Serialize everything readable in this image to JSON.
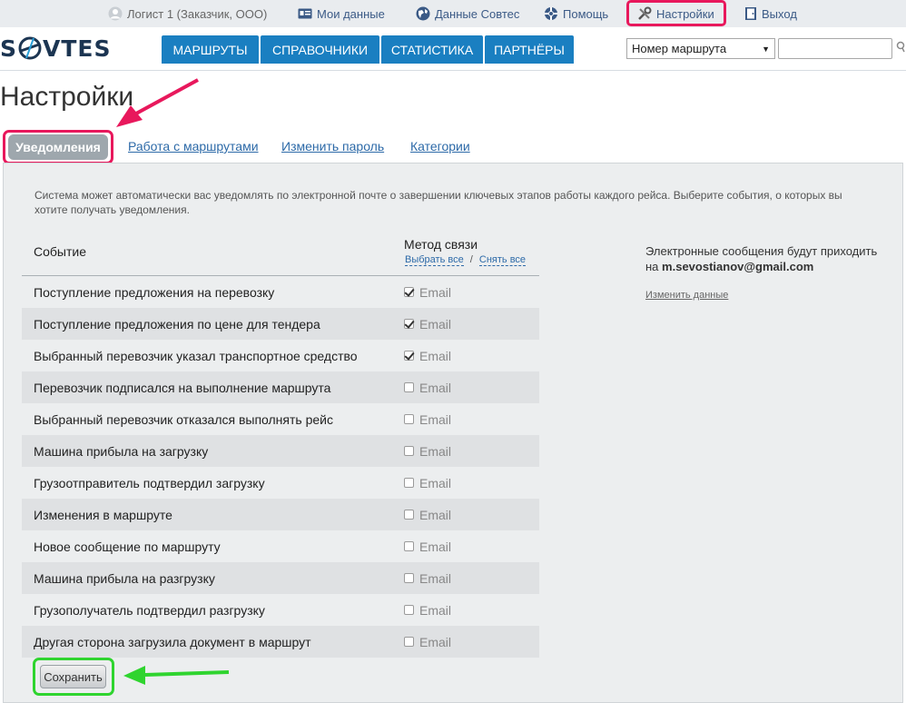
{
  "topbar": {
    "user": "Логист 1 (Заказчик, ООО)",
    "my_data": "Мои данные",
    "sovtes_data": "Данные Совтес",
    "help": "Помощь",
    "settings": "Настройки",
    "logout": "Выход"
  },
  "logo": {
    "text": "SOVTES",
    "left": "S",
    "right": "VTES"
  },
  "mainnav": [
    "МАРШРУТЫ",
    "СПРАВОЧНИКИ",
    "СТАТИСТИКА",
    "ПАРТНЁРЫ"
  ],
  "search": {
    "select_value": "Номер маршрута",
    "input_value": ""
  },
  "page_title": "Настройки",
  "subtabs": {
    "active": "Уведомления",
    "routes": "Работа с маршрутами",
    "password": "Изменить пароль",
    "categories": "Категории"
  },
  "intro": "Система может автоматически вас уведомлять по электронной почте о завершении ключевых этапов работы каждого рейса. Выберите события, о которых вы хотите получать уведомления.",
  "table": {
    "col_event": "Событие",
    "col_method": "Метод связи",
    "select_all": "Выбрать все",
    "separator": "/",
    "deselect_all": "Снять все",
    "rows": [
      {
        "event": "Поступление предложения на перевозку",
        "method": "Email",
        "checked": true
      },
      {
        "event": "Поступление предложения по цене для тендера",
        "method": "Email",
        "checked": true
      },
      {
        "event": "Выбранный перевозчик указал транспортное средство",
        "method": "Email",
        "checked": true
      },
      {
        "event": "Перевозчик подписался на выполнение маршрута",
        "method": "Email",
        "checked": false
      },
      {
        "event": "Выбранный перевозчик отказался выполнять рейс",
        "method": "Email",
        "checked": false
      },
      {
        "event": "Машина прибыла на загрузку",
        "method": "Email",
        "checked": false
      },
      {
        "event": "Грузоотправитель подтвердил загрузку",
        "method": "Email",
        "checked": false
      },
      {
        "event": "Изменения в маршруте",
        "method": "Email",
        "checked": false
      },
      {
        "event": "Новое сообщение по маршруту",
        "method": "Email",
        "checked": false
      },
      {
        "event": "Машина прибыла на разгрузку",
        "method": "Email",
        "checked": false
      },
      {
        "event": "Грузополучатель подтвердил разгрузку",
        "method": "Email",
        "checked": false
      },
      {
        "event": "Другая сторона загрузила документ в маршрут",
        "method": "Email",
        "checked": false
      }
    ]
  },
  "side": {
    "text_1": "Электронные сообщения будут приходить",
    "text_2": "на",
    "email": "m.sevostianov@gmail.com",
    "change_link": "Изменить данные"
  },
  "save_button": "Сохранить",
  "colors": {
    "nav_blue": "#1a7fc1",
    "highlight_pink": "#e8185c",
    "highlight_green": "#2fd42f"
  }
}
